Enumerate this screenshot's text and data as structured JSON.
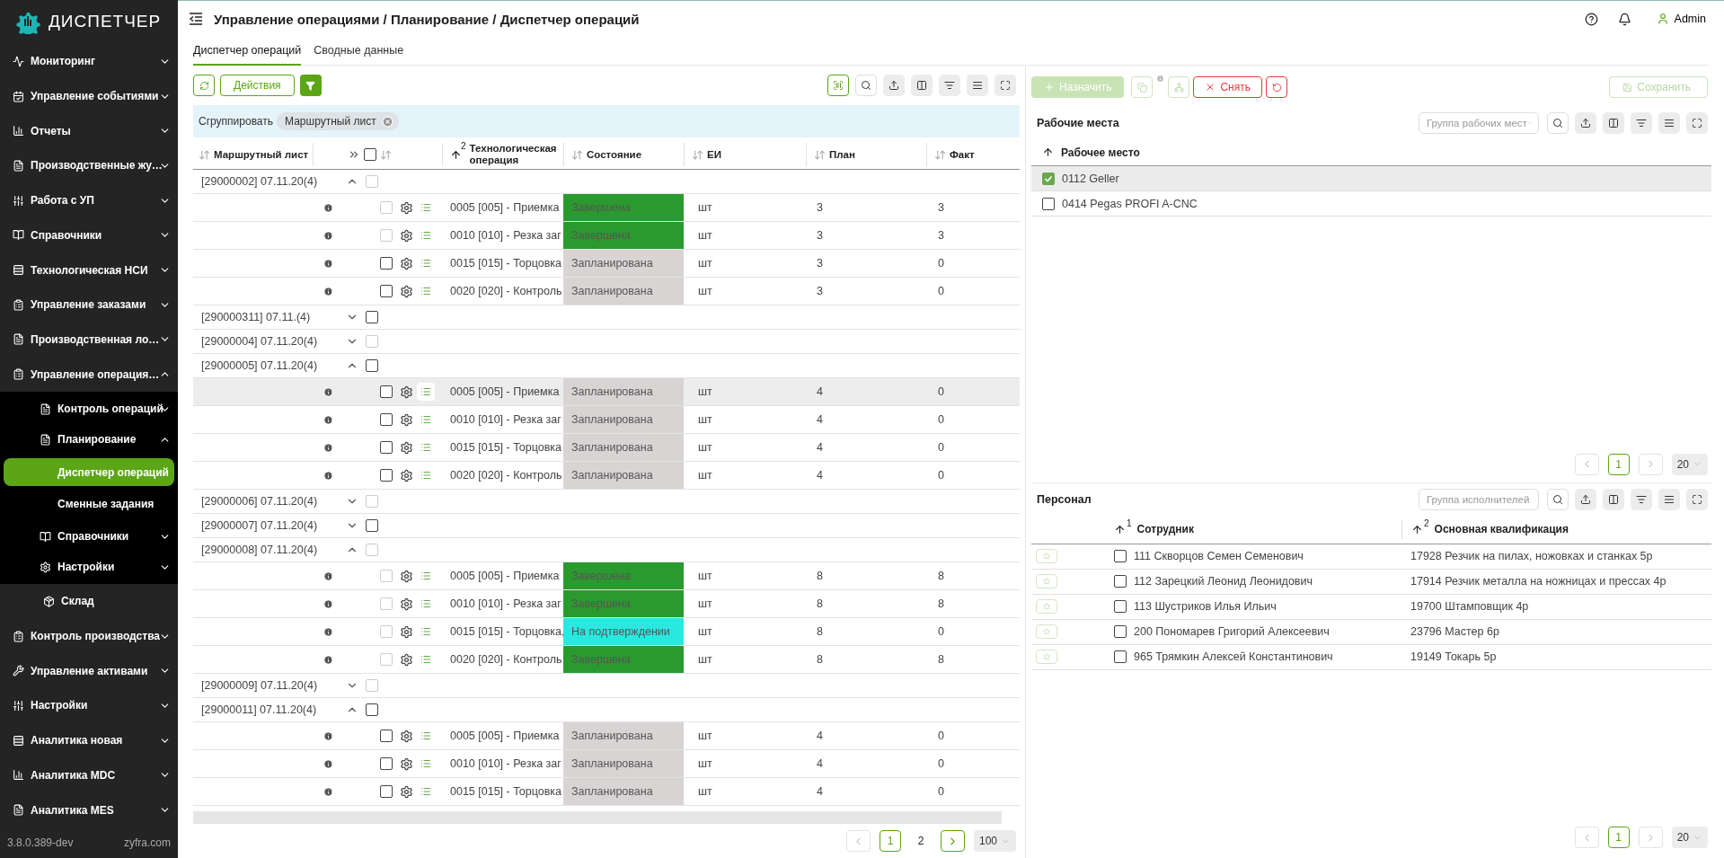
{
  "sidebar": {
    "logo": "ДИСПЕТЧЕР",
    "items": [
      {
        "kind": "menu",
        "label": "Мониторинг",
        "expanded": false
      },
      {
        "kind": "menu",
        "label": "Управление событиями",
        "expanded": false
      },
      {
        "kind": "menu",
        "label": "Отчеты",
        "expanded": false
      },
      {
        "kind": "menu",
        "label": "Производственные жу…",
        "expanded": false
      },
      {
        "kind": "menu",
        "label": "Работа с УП",
        "expanded": false
      },
      {
        "kind": "menu",
        "label": "Справочники",
        "expanded": false
      },
      {
        "kind": "menu",
        "label": "Технологическая НСИ",
        "expanded": false
      },
      {
        "kind": "menu",
        "label": "Управление заказами",
        "expanded": false
      },
      {
        "kind": "menu",
        "label": "Производственная ло…",
        "expanded": false
      },
      {
        "kind": "menu",
        "label": "Управление операция…",
        "expanded": true,
        "children": [
          {
            "kind": "menu",
            "label": "Контроль операций",
            "expanded": false
          },
          {
            "kind": "menu",
            "label": "Планирование",
            "expanded": true,
            "children": [
              {
                "kind": "link",
                "label": "Диспетчер операций",
                "selected": true
              },
              {
                "kind": "link",
                "label": "Сменные задания",
                "selected": false
              }
            ]
          },
          {
            "kind": "menu",
            "label": "Справочники",
            "expanded": false
          },
          {
            "kind": "menu",
            "label": "Настройки",
            "expanded": false
          }
        ]
      },
      {
        "kind": "link",
        "label": "Склад"
      },
      {
        "kind": "menu",
        "label": "Контроль производства",
        "expanded": false
      },
      {
        "kind": "menu",
        "label": "Управление активами",
        "expanded": false
      },
      {
        "kind": "menu",
        "label": "Настройки",
        "expanded": false
      },
      {
        "kind": "menu",
        "label": "Аналитика новая",
        "expanded": false
      },
      {
        "kind": "menu",
        "label": "Аналитика MDC",
        "expanded": false
      },
      {
        "kind": "menu",
        "label": "Аналитика MES",
        "expanded": false
      }
    ],
    "version": "3.8.0.389-dev",
    "site": "zyfra.com"
  },
  "header": {
    "breadcrumb": "Управление операциями / Планирование / Диспетчер операций",
    "user": "Admin"
  },
  "tabs": [
    {
      "label": "Диспетчер операций",
      "selected": true
    },
    {
      "label": "Сводные данные",
      "selected": false
    }
  ],
  "toolbar": {
    "actions_label": "Действия",
    "group_label": "Сгруппировать",
    "group_chip": "Маршрутный лист"
  },
  "table": {
    "columns": [
      {
        "kind": "text",
        "label": "Маршрутный лист",
        "sorted": false
      },
      {
        "kind": "controls",
        "checked": false,
        "sorted": false
      },
      {
        "kind": "text",
        "label": "Технологическая операция",
        "sorted": true,
        "sort_order": "2"
      },
      {
        "kind": "text",
        "label": "Состояние",
        "sorted": false
      },
      {
        "kind": "text",
        "label": "ЕИ",
        "sorted": false
      },
      {
        "kind": "text",
        "label": "План",
        "sorted": false
      },
      {
        "kind": "text",
        "label": "Факт",
        "sorted": false
      }
    ],
    "groups": [
      {
        "label": "[29000002] 07.11.20(4)",
        "expanded": true,
        "checkbox_disabled": true,
        "children": [
          {
            "operation": "0005 [005] - Приемка",
            "state": "Завершена",
            "color": "#2a9a2e",
            "unit": "шт",
            "plan": "3",
            "fact": "3",
            "checkbox_disabled": true,
            "selected": false
          },
          {
            "operation": "0010 [010] - Резка заг",
            "state": "Завершена",
            "color": "#2a9a2e",
            "unit": "шт",
            "plan": "3",
            "fact": "3",
            "checkbox_disabled": true,
            "selected": false
          },
          {
            "operation": "0015 [015] - Торцовка",
            "state": "Запланирована",
            "color": "#d9d4d4",
            "unit": "шт",
            "plan": "3",
            "fact": "0",
            "checkbox_disabled": false,
            "selected": false
          },
          {
            "operation": "0020 [020] - Контроль",
            "state": "Запланирована",
            "color": "#d9d4d4",
            "unit": "шт",
            "plan": "3",
            "fact": "0",
            "checkbox_disabled": false,
            "selected": false
          }
        ]
      },
      {
        "label": "[290000311] 07.11.(4)",
        "expanded": false,
        "checkbox_disabled": false
      },
      {
        "label": "[29000004] 07.11.20(4)",
        "expanded": false,
        "checkbox_disabled": true
      },
      {
        "label": "[29000005] 07.11.20(4)",
        "expanded": true,
        "checkbox_disabled": false,
        "children": [
          {
            "operation": "0005 [005] - Приемка",
            "state": "Запланирована",
            "color": "#d9d4d4",
            "unit": "шт",
            "plan": "4",
            "fact": "0",
            "checkbox_disabled": false,
            "selected": true
          },
          {
            "operation": "0010 [010] - Резка заг",
            "state": "Запланирована",
            "color": "#d9d4d4",
            "unit": "шт",
            "plan": "4",
            "fact": "0",
            "checkbox_disabled": false,
            "selected": false
          },
          {
            "operation": "0015 [015] - Торцовка",
            "state": "Запланирована",
            "color": "#d9d4d4",
            "unit": "шт",
            "plan": "4",
            "fact": "0",
            "checkbox_disabled": false,
            "selected": false
          },
          {
            "operation": "0020 [020] - Контроль",
            "state": "Запланирована",
            "color": "#d9d4d4",
            "unit": "шт",
            "plan": "4",
            "fact": "0",
            "checkbox_disabled": false,
            "selected": false
          }
        ]
      },
      {
        "label": "[29000006] 07.11.20(4)",
        "expanded": false,
        "checkbox_disabled": true
      },
      {
        "label": "[29000007] 07.11.20(4)",
        "expanded": false,
        "checkbox_disabled": false
      },
      {
        "label": "[29000008] 07.11.20(4)",
        "expanded": true,
        "checkbox_disabled": true,
        "children": [
          {
            "operation": "0005 [005] - Приемка",
            "state": "Завершена",
            "color": "#2a9a2e",
            "unit": "шт",
            "plan": "8",
            "fact": "8",
            "checkbox_disabled": true,
            "selected": false
          },
          {
            "operation": "0010 [010] - Резка заг",
            "state": "Завершена",
            "color": "#2a9a2e",
            "unit": "шт",
            "plan": "8",
            "fact": "8",
            "checkbox_disabled": true,
            "selected": false
          },
          {
            "operation": "0015 [015] - Торцовка,",
            "state": "На подтверждении",
            "color": "#2ae8e0",
            "unit": "шт",
            "plan": "8",
            "fact": "0",
            "checkbox_disabled": true,
            "selected": false
          },
          {
            "operation": "0020 [020] - Контроль",
            "state": "Завершена",
            "color": "#2a9a2e",
            "unit": "шт",
            "plan": "8",
            "fact": "8",
            "checkbox_disabled": true,
            "selected": false
          }
        ]
      },
      {
        "label": "[29000009] 07.11.20(4)",
        "expanded": false,
        "checkbox_disabled": true
      },
      {
        "label": "[29000011] 07.11.20(4)",
        "expanded": true,
        "checkbox_disabled": false,
        "children": [
          {
            "operation": "0005 [005] - Приемка",
            "state": "Запланирована",
            "color": "#d9d4d4",
            "unit": "шт",
            "plan": "4",
            "fact": "0",
            "checkbox_disabled": false,
            "selected": false
          },
          {
            "operation": "0010 [010] - Резка заг",
            "state": "Запланирована",
            "color": "#d9d4d4",
            "unit": "шт",
            "plan": "4",
            "fact": "0",
            "checkbox_disabled": false,
            "selected": false
          },
          {
            "operation": "0015 [015] - Торцовка",
            "state": "Запланирована",
            "color": "#d9d4d4",
            "unit": "шт",
            "plan": "4",
            "fact": "0",
            "checkbox_disabled": false,
            "selected": false
          }
        ]
      }
    ],
    "pagination": {
      "prev_disabled": true,
      "next_disabled": false,
      "pages": [
        {
          "label": "1",
          "selected": true
        },
        {
          "label": "2",
          "selected": false
        }
      ],
      "page_size": "100"
    }
  },
  "assignment": {
    "actions": [
      {
        "kind": "assign",
        "label": "Назначить",
        "disabled": true
      },
      {
        "kind": "copy",
        "disabled": true
      },
      {
        "kind": "structure",
        "disabled": true
      },
      {
        "kind": "remove",
        "label": "Снять",
        "disabled": false
      },
      {
        "kind": "reset",
        "disabled": false
      }
    ],
    "save": {
      "label": "Сохранить",
      "disabled": true
    },
    "workplaces": {
      "title": "Рабочие места",
      "filter_placeholder": "Группа рабочих мест",
      "column": "Рабочее место",
      "rows": [
        {
          "name": "0112 Geller",
          "checked": true
        },
        {
          "name": "0414 Pegas PROFI A-CNC",
          "checked": false
        }
      ],
      "pagination": {
        "prev_disabled": true,
        "next_disabled": true,
        "pages": [
          {
            "label": "1",
            "selected": true
          }
        ],
        "page_size": "20"
      }
    },
    "staff": {
      "title": "Персонал",
      "filter_placeholder": "Группа исполнителей",
      "columns": [
        {
          "label": "Сотрудник",
          "sort_order": "1"
        },
        {
          "label": "Основная квалификация",
          "sort_order": "2"
        }
      ],
      "rows": [
        {
          "name": "111 Скворцов Семен Семенович",
          "qualification": "17928 Резчик на пилах, ножовках и станках 5р",
          "checked": false
        },
        {
          "name": "112 Зарецкий Леонид Леонидович",
          "qualification": "17914 Резчик металла на ножницах и прессах 4р",
          "checked": false
        },
        {
          "name": "113 Шустриков Илья Ильич",
          "qualification": "19700 Штамповщик 4р",
          "checked": false
        },
        {
          "name": "200 Пономарев Григорий Алексеевич",
          "qualification": "23796 Мастер 6р",
          "checked": false
        },
        {
          "name": "965 Трямкин Алексей Константинович",
          "qualification": "19149 Токарь 5р",
          "checked": false
        }
      ],
      "pagination": {
        "prev_disabled": true,
        "next_disabled": true,
        "pages": [
          {
            "label": "1",
            "selected": true
          }
        ],
        "page_size": "20"
      }
    }
  }
}
